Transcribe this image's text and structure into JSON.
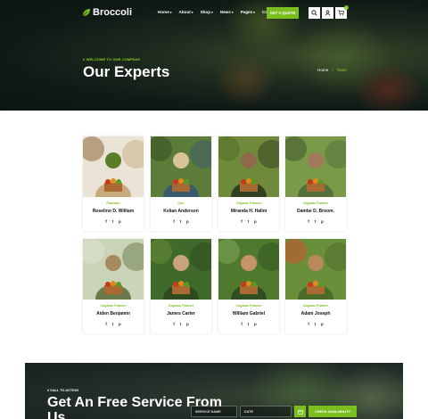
{
  "brand": {
    "name": "Broccoli",
    "accent": "#7bbf1e"
  },
  "nav": {
    "items": [
      {
        "label": "Home",
        "caret": true
      },
      {
        "label": "About",
        "caret": true
      },
      {
        "label": "Shop",
        "caret": true
      },
      {
        "label": "News",
        "caret": true
      },
      {
        "label": "Pages",
        "caret": true
      },
      {
        "label": "Contact",
        "caret": false
      }
    ],
    "quote_label": "GET A QUOTE",
    "icons": [
      "search-icon",
      "user-icon",
      "cart-icon"
    ],
    "cart_count": "0"
  },
  "hero": {
    "subtitle": "// WELCOME TO OUR COMPANY",
    "title": "Our Experts",
    "breadcrumb": {
      "home": "Home",
      "separator": "/",
      "current": "Team"
    }
  },
  "team": [
    {
      "role": "Founder",
      "name": "Roselino D. William"
    },
    {
      "role": "Ceo",
      "name": "Kelian Anderson"
    },
    {
      "role": "Organic Farmer",
      "name": "Miranda H. Halim"
    },
    {
      "role": "Organic Farmer",
      "name": "Dambe D. Broom."
    },
    {
      "role": "Organic Farmer",
      "name": "Aiden Benjamin"
    },
    {
      "role": "Organic Farmer",
      "name": "James Carter"
    },
    {
      "role": "Organic Farmer",
      "name": "William Gabriel"
    },
    {
      "role": "Organic Farmer",
      "name": "Adam Joseph"
    }
  ],
  "social": [
    "f",
    "t",
    "p"
  ],
  "cta": {
    "subtitle": "// CALL TO ACTION",
    "title": "Get An Free Service From Us",
    "name_placeholder": "SERVICE NAME",
    "date_placeholder": "DATE",
    "button_label": "CHECK AVAILABILITY"
  }
}
